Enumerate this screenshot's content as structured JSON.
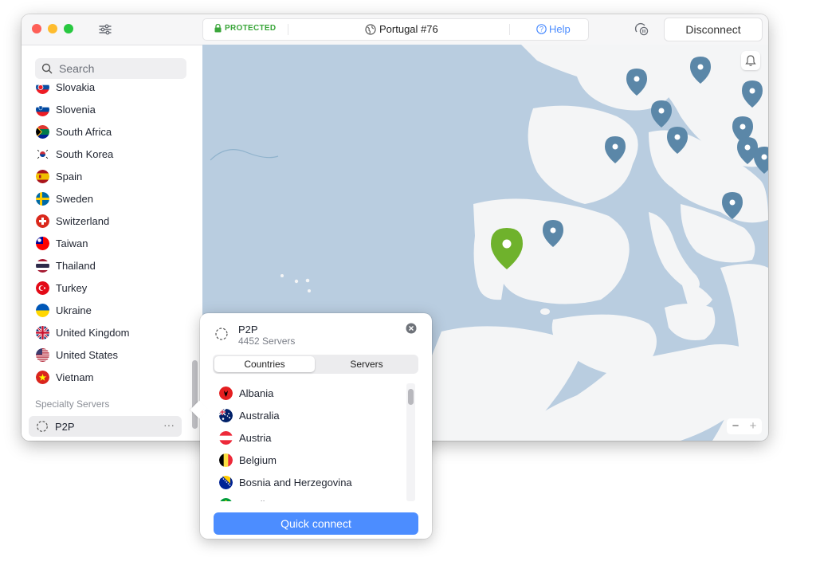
{
  "titlebar": {
    "status": "PROTECTED",
    "server": "Portugal #76",
    "help": "Help",
    "disconnect": "Disconnect"
  },
  "sidebar": {
    "search_placeholder": "Search",
    "countries": [
      {
        "label": "Slovakia",
        "flag": "sk"
      },
      {
        "label": "Slovenia",
        "flag": "si"
      },
      {
        "label": "South Africa",
        "flag": "za"
      },
      {
        "label": "South Korea",
        "flag": "kr"
      },
      {
        "label": "Spain",
        "flag": "es"
      },
      {
        "label": "Sweden",
        "flag": "se"
      },
      {
        "label": "Switzerland",
        "flag": "ch"
      },
      {
        "label": "Taiwan",
        "flag": "tw"
      },
      {
        "label": "Thailand",
        "flag": "th"
      },
      {
        "label": "Turkey",
        "flag": "tr"
      },
      {
        "label": "Ukraine",
        "flag": "ua"
      },
      {
        "label": "United Kingdom",
        "flag": "gb"
      },
      {
        "label": "United States",
        "flag": "us"
      },
      {
        "label": "Vietnam",
        "flag": "vn"
      }
    ],
    "specialty_label": "Specialty Servers",
    "p2p_label": "P2P",
    "more": "···"
  },
  "popover": {
    "title": "P2P",
    "subtitle": "4452 Servers",
    "tabs": [
      "Countries",
      "Servers"
    ],
    "countries": [
      {
        "label": "Albania",
        "flag": "al"
      },
      {
        "label": "Australia",
        "flag": "au"
      },
      {
        "label": "Austria",
        "flag": "at"
      },
      {
        "label": "Belgium",
        "flag": "be"
      },
      {
        "label": "Bosnia and Herzegovina",
        "flag": "ba"
      },
      {
        "label": "Brazil",
        "flag": "br"
      }
    ],
    "quick_connect": "Quick connect"
  },
  "map": {
    "zoom_out": "−",
    "zoom_in": "+"
  },
  "colors": {
    "accent": "#4c8dff",
    "protected": "#3aa63a",
    "map_water": "#b9cde0",
    "map_land": "#f4f5f6",
    "pin": "#5b87a8",
    "active_pin": "#6fb22c"
  }
}
